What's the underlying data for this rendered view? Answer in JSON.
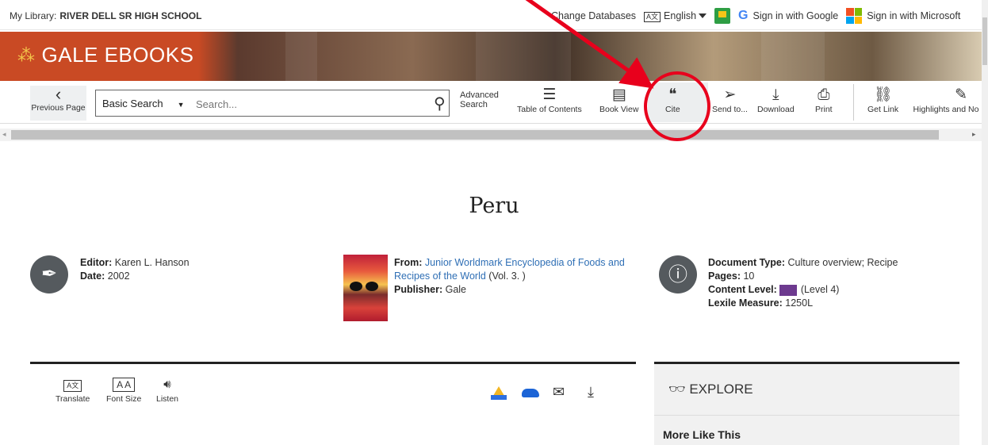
{
  "topbar": {
    "library_label": "My Library:",
    "library_name": "RIVER DELL SR HIGH SCHOOL",
    "change_databases": "Change Databases",
    "language": "English",
    "google_signin": "Sign in with Google",
    "microsoft_signin": "Sign in with Microsoft"
  },
  "banner": {
    "brand": "GALE EBOOKS"
  },
  "toolbar": {
    "previous_page": "Previous Page",
    "search_type": "Basic Search",
    "search_placeholder": "Search...",
    "advanced_search_1": "Advanced",
    "advanced_search_2": "Search",
    "table_of_contents": "Table of Contents",
    "book_view": "Book View",
    "cite": "Cite",
    "send_to": "Send to...",
    "download": "Download",
    "print": "Print",
    "get_link": "Get Link",
    "highlights": "Highlights and No"
  },
  "document": {
    "title": "Peru",
    "editor_label": "Editor:",
    "editor": "Karen L. Hanson",
    "date_label": "Date:",
    "date": "2002",
    "from_label": "From:",
    "from_title": "Junior Worldmark Encyclopedia of Foods and Recipes of the World",
    "volume": "(Vol. 3. )",
    "publisher_label": "Publisher:",
    "publisher": "Gale",
    "doc_type_label": "Document Type:",
    "doc_type": "Culture overview; Recipe",
    "pages_label": "Pages:",
    "pages": "10",
    "content_level_label": "Content Level:",
    "content_level": "(Level 4)",
    "lexile_label": "Lexile Measure:",
    "lexile": "1250L"
  },
  "tools": {
    "translate": "Translate",
    "font_size": "Font Size",
    "listen": "Listen"
  },
  "explore": {
    "heading": "EXPLORE",
    "more_like_this": "More Like This"
  },
  "annotation": {
    "color": "#e8001c"
  }
}
